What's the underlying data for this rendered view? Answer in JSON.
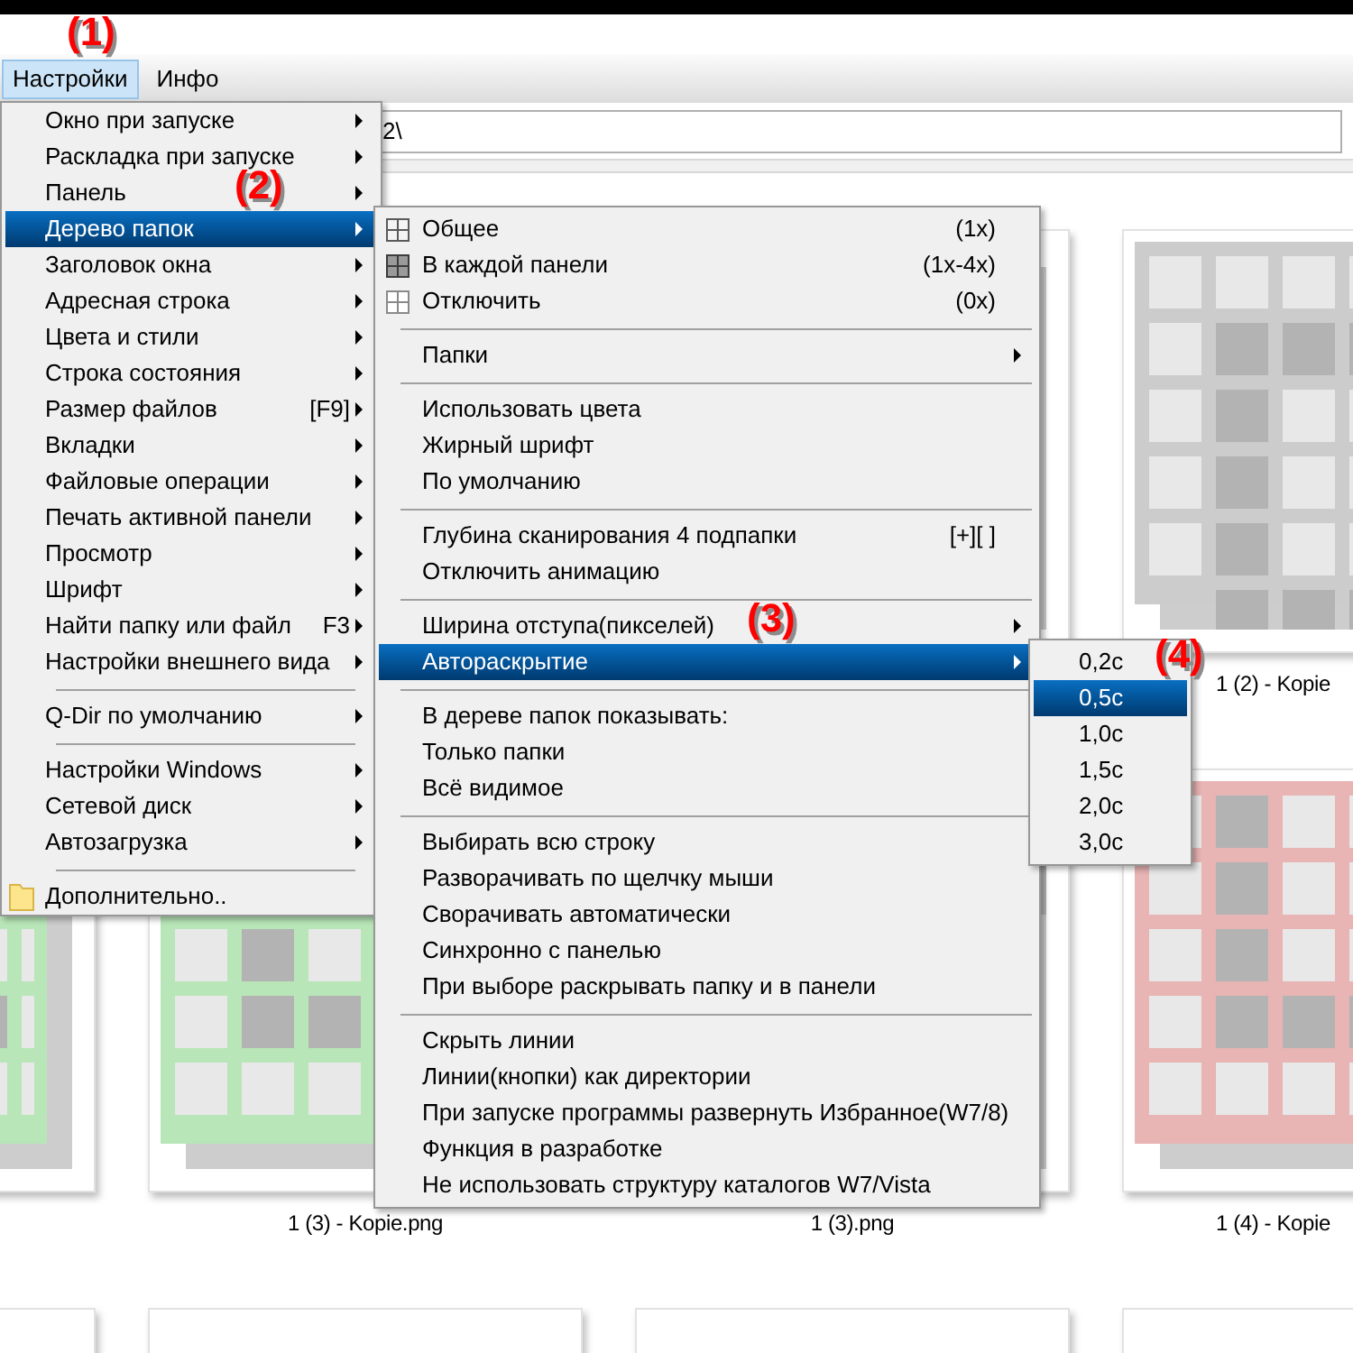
{
  "annotations": [
    {
      "text": "(1)"
    },
    {
      "text": "(2)"
    },
    {
      "text": "(3)"
    },
    {
      "text": "(4)"
    }
  ],
  "menubar": [
    {
      "label": "Настройки",
      "selected": true
    },
    {
      "label": "Инфо",
      "selected": false
    }
  ],
  "address_bar": {
    "value": "2\\"
  },
  "files": [
    {
      "kind": "covered"
    },
    {
      "kind": "covered"
    },
    {
      "kind": "picture"
    },
    {
      "kind": "picture",
      "label": "1 (2) - Kopie"
    },
    {
      "kind": "picture"
    },
    {
      "kind": "picture",
      "label": "1 (3) - Kopie.png"
    },
    {
      "kind": "picture",
      "label": "1 (3).png"
    },
    {
      "kind": "picture",
      "label": "1 (4) - Kopie"
    },
    {
      "kind": "card"
    },
    {
      "kind": "card"
    },
    {
      "kind": "card"
    },
    {
      "kind": "card"
    }
  ],
  "settings_menu": {
    "items": [
      {
        "kind": "item",
        "label": "Окно при запуске",
        "submenu": true,
        "selected": false
      },
      {
        "kind": "item",
        "label": "Раскладка при запуске",
        "submenu": true,
        "selected": false
      },
      {
        "kind": "item",
        "label": "Панель",
        "submenu": true,
        "selected": false
      },
      {
        "kind": "item",
        "label": "Дерево папок",
        "submenu": true,
        "selected": true
      },
      {
        "kind": "item",
        "label": "Заголовок окна",
        "submenu": true,
        "selected": false
      },
      {
        "kind": "item",
        "label": "Адресная строка",
        "submenu": true,
        "selected": false
      },
      {
        "kind": "item",
        "label": "Цвета и стили",
        "submenu": true,
        "selected": false
      },
      {
        "kind": "item",
        "label": "Строка состояния",
        "submenu": true,
        "selected": false
      },
      {
        "kind": "item",
        "label": "Размер файлов",
        "shortcut": "[F9]",
        "submenu": true,
        "selected": false
      },
      {
        "kind": "item",
        "label": "Вкладки",
        "submenu": true,
        "selected": false
      },
      {
        "kind": "item",
        "label": "Файловые операции",
        "submenu": true,
        "selected": false
      },
      {
        "kind": "item",
        "label": "Печать активной панели",
        "submenu": true,
        "selected": false
      },
      {
        "kind": "item",
        "label": "Просмотр",
        "submenu": true,
        "selected": false
      },
      {
        "kind": "item",
        "label": "Шрифт",
        "submenu": true,
        "selected": false
      },
      {
        "kind": "item",
        "label": "Найти папку или файл",
        "shortcut": "F3",
        "submenu": true,
        "selected": false
      },
      {
        "kind": "item",
        "label": "Настройки внешнего вида",
        "submenu": true,
        "selected": false
      },
      {
        "kind": "separator"
      },
      {
        "kind": "item",
        "label": "Q-Dir по умолчанию",
        "submenu": true,
        "selected": false
      },
      {
        "kind": "separator"
      },
      {
        "kind": "item",
        "label": "Настройки Windows",
        "submenu": true,
        "selected": false
      },
      {
        "kind": "item",
        "label": "Сетевой диск",
        "submenu": true,
        "selected": false
      },
      {
        "kind": "item",
        "label": "Автозагрузка",
        "submenu": true,
        "selected": false
      },
      {
        "kind": "separator"
      },
      {
        "kind": "icon_item",
        "label": "Дополнительно..",
        "submenu": false,
        "selected": false
      }
    ]
  },
  "folder_tree_menu": {
    "items": [
      {
        "kind": "icon_item",
        "label": "Общее",
        "shortcut": "(1x)",
        "submenu": false,
        "selected": false
      },
      {
        "kind": "icon_item",
        "label": "В каждой панели",
        "shortcut": "(1x-4x)",
        "submenu": false,
        "selected": false
      },
      {
        "kind": "icon_item",
        "label": "Отключить",
        "shortcut": "(0x)",
        "submenu": false,
        "selected": false
      },
      {
        "kind": "separator"
      },
      {
        "kind": "item",
        "label": "Папки",
        "submenu": true,
        "selected": false
      },
      {
        "kind": "separator"
      },
      {
        "kind": "item",
        "label": "Использовать цвета",
        "submenu": false,
        "selected": false
      },
      {
        "kind": "item",
        "label": "Жирный шрифт",
        "submenu": false,
        "selected": false
      },
      {
        "kind": "item",
        "label": "По умолчанию",
        "submenu": false,
        "selected": false
      },
      {
        "kind": "separator"
      },
      {
        "kind": "item",
        "label": "Глубина сканирования 4 подпапки",
        "shortcut": "[+][ ]",
        "submenu": false,
        "selected": false
      },
      {
        "kind": "item",
        "label": "Отключить анимацию",
        "submenu": false,
        "selected": false
      },
      {
        "kind": "separator"
      },
      {
        "kind": "item",
        "label": "Ширина отступа(пикселей)",
        "submenu": true,
        "selected": false
      },
      {
        "kind": "item",
        "label": "Автораскрытие",
        "submenu": true,
        "selected": true
      },
      {
        "kind": "separator"
      },
      {
        "kind": "item",
        "label": "В дереве папок показывать:",
        "submenu": false,
        "selected": false
      },
      {
        "kind": "item",
        "label": "Только папки",
        "submenu": false,
        "selected": false
      },
      {
        "kind": "item",
        "label": "Всё видимое",
        "submenu": false,
        "selected": false
      },
      {
        "kind": "separator"
      },
      {
        "kind": "item",
        "label": "Выбирать всю строку",
        "submenu": false,
        "selected": false
      },
      {
        "kind": "item",
        "label": "Разворачивать по щелчку мыши",
        "submenu": false,
        "selected": false
      },
      {
        "kind": "item",
        "label": "Сворачивать автоматически",
        "submenu": false,
        "selected": false
      },
      {
        "kind": "item",
        "label": "Синхронно с панелью",
        "submenu": false,
        "selected": false
      },
      {
        "kind": "item",
        "label": "При выборе раскрывать папку и в панели",
        "submenu": false,
        "selected": false
      },
      {
        "kind": "separator"
      },
      {
        "kind": "item",
        "label": "Скрыть линии",
        "submenu": false,
        "selected": false
      },
      {
        "kind": "item",
        "label": "Линии(кнопки) как директории",
        "submenu": false,
        "selected": false
      },
      {
        "kind": "item",
        "label": "При запуске программы развернуть Избранное(W7/8)",
        "submenu": false,
        "selected": false
      },
      {
        "kind": "item",
        "label": "Функция в разработке",
        "submenu": false,
        "selected": false
      },
      {
        "kind": "item",
        "label": "Не использовать структуру каталогов W7/Vista",
        "submenu": false,
        "selected": false
      }
    ]
  },
  "autoexpand_menu": {
    "items": [
      {
        "kind": "item",
        "label": "0,2c",
        "submenu": false,
        "selected": false
      },
      {
        "kind": "item",
        "label": "0,5c",
        "submenu": false,
        "selected": true
      },
      {
        "kind": "item",
        "label": "1,0c",
        "submenu": false,
        "selected": false
      },
      {
        "kind": "item",
        "label": "1,5c",
        "submenu": false,
        "selected": false
      },
      {
        "kind": "item",
        "label": "2,0c",
        "submenu": false,
        "selected": false
      },
      {
        "kind": "item",
        "label": "3,0c",
        "submenu": false,
        "selected": false
      }
    ]
  }
}
